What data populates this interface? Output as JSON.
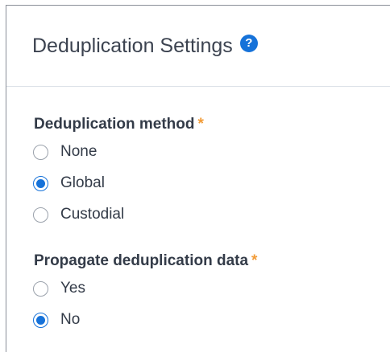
{
  "header": {
    "title": "Deduplication Settings",
    "help_glyph": "?"
  },
  "dedup_method": {
    "label": "Deduplication method",
    "required_mark": "*",
    "selected": "Global",
    "options": [
      {
        "label": "None",
        "checked": false
      },
      {
        "label": "Global",
        "checked": true
      },
      {
        "label": "Custodial",
        "checked": false
      }
    ]
  },
  "propagate": {
    "label": "Propagate deduplication data",
    "required_mark": "*",
    "selected": "No",
    "options": [
      {
        "label": "Yes",
        "checked": false
      },
      {
        "label": "No",
        "checked": true
      }
    ]
  },
  "colors": {
    "accent": "#1672d9",
    "required": "#f29c38",
    "text": "#333b48"
  }
}
